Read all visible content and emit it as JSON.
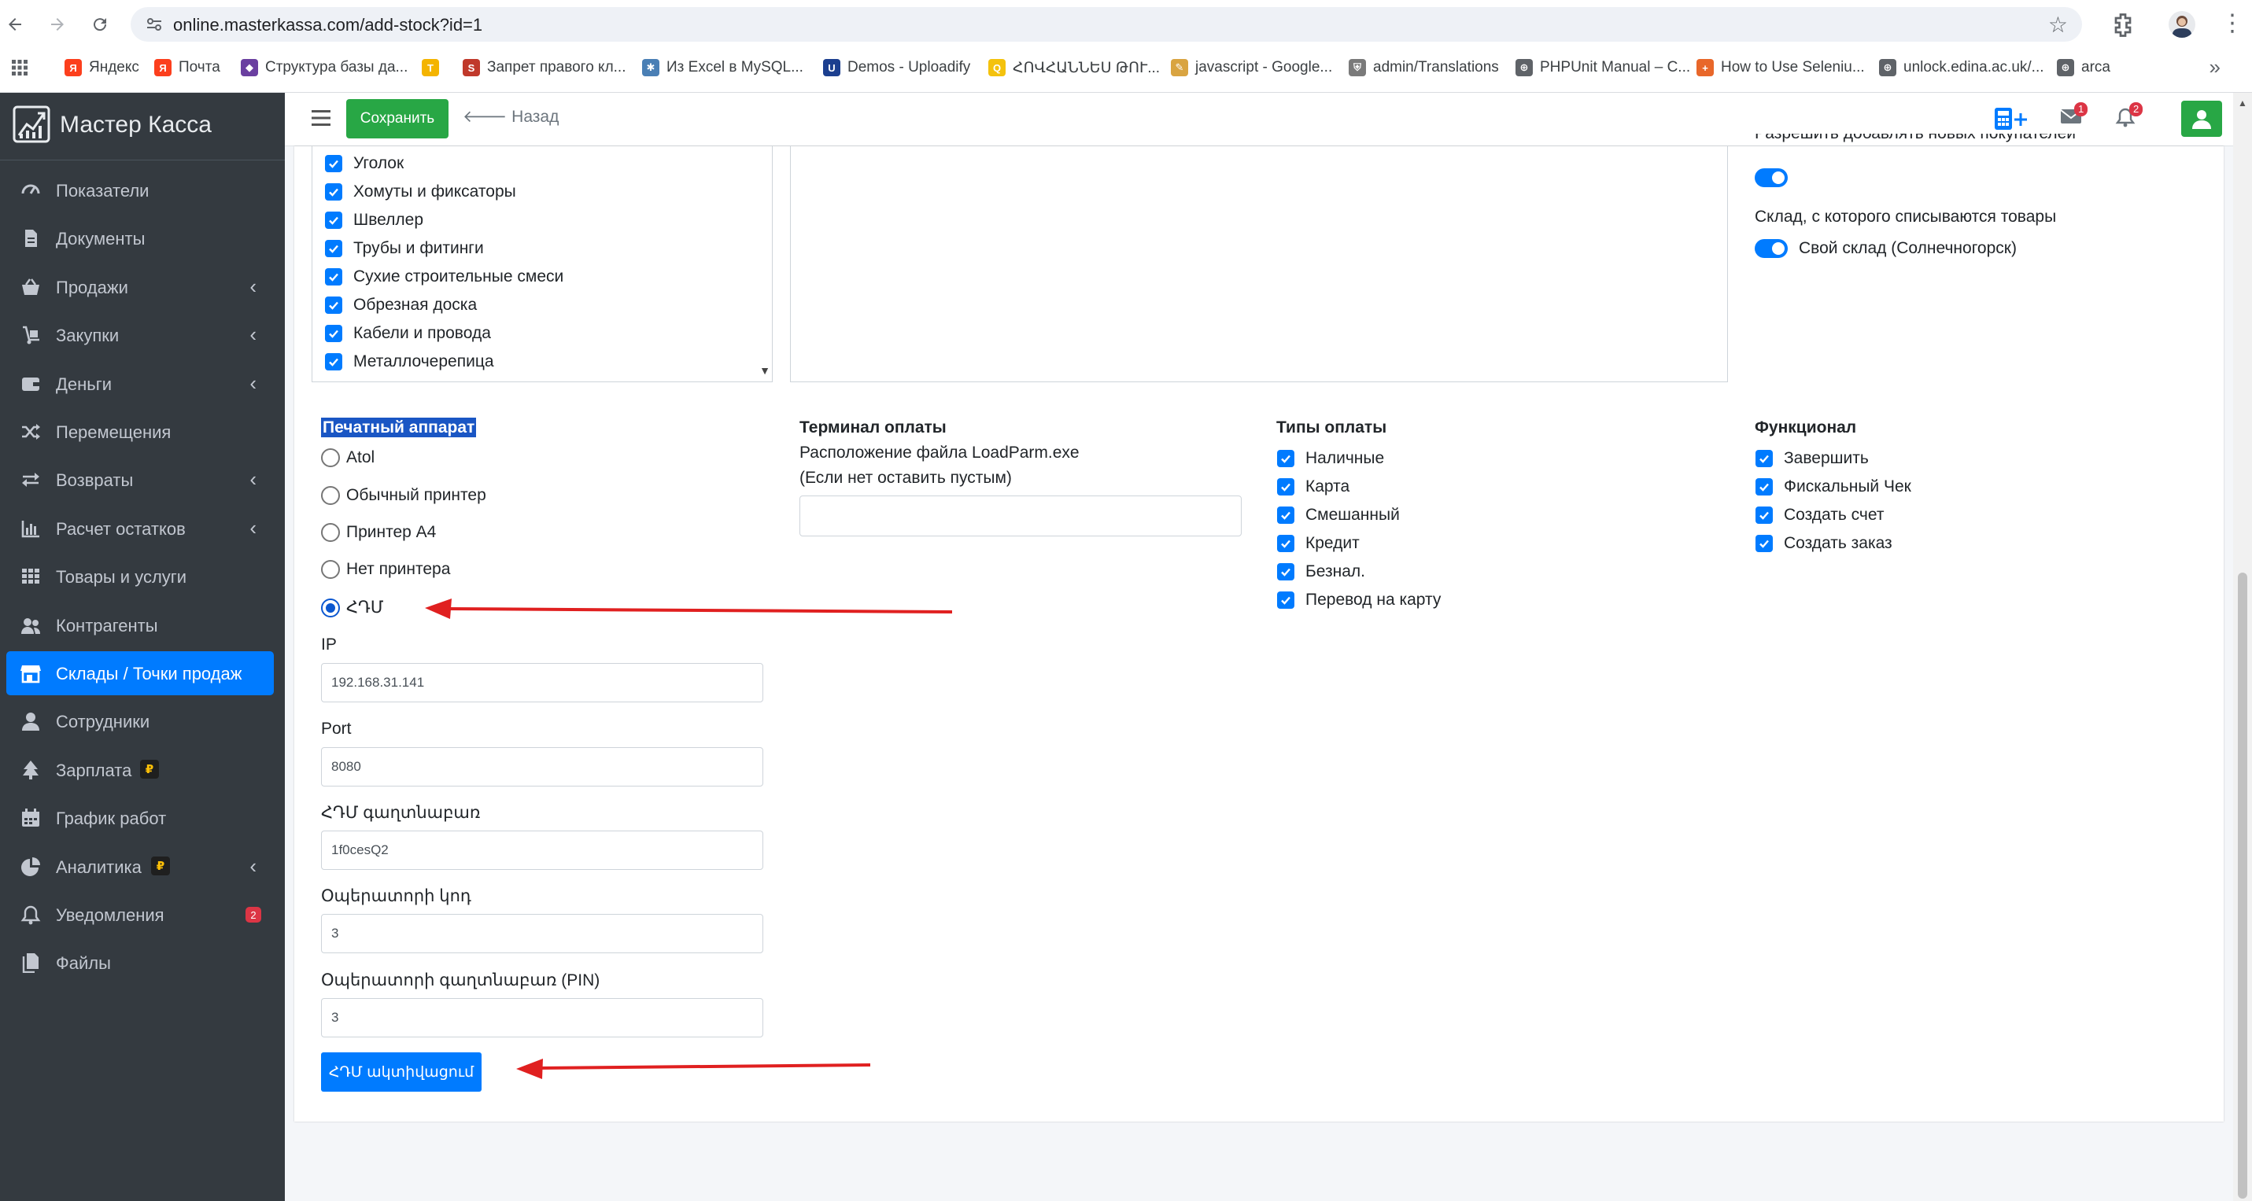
{
  "browser": {
    "url": "online.masterkassa.com/add-stock?id=1",
    "bookmarks": [
      {
        "label": "Яндекс",
        "icon": "yandex-icon",
        "color": "#fc3f1d",
        "glyph": "Я"
      },
      {
        "label": "Почта",
        "icon": "yandex-mail-icon",
        "color": "#fc3f1d",
        "glyph": "Я"
      },
      {
        "label": "Структура базы да...",
        "icon": "diamond-icon",
        "color": "#6a3fa0",
        "glyph": "◆"
      },
      {
        "label": "",
        "icon": "t-icon",
        "color": "#f4b400",
        "glyph": "T"
      },
      {
        "label": "Запрет правого кл...",
        "icon": "s-icon",
        "color": "#c0392b",
        "glyph": "S"
      },
      {
        "label": "Из Excel в MySQL...",
        "icon": "excel-mysql-icon",
        "color": "#4a7fb5",
        "glyph": "✱"
      },
      {
        "label": "Demos - Uploadify",
        "icon": "uploadify-icon",
        "color": "#1c3f8f",
        "glyph": "U"
      },
      {
        "label": "ՀՈՎՀԱՆՆԵՍ ԹՈՒ...",
        "icon": "qr-icon",
        "color": "#f4c20d",
        "glyph": "Q"
      },
      {
        "label": "javascript - Google...",
        "icon": "doc-icon",
        "color": "#d9a441",
        "glyph": "✎"
      },
      {
        "label": "admin/Translations",
        "icon": "shield-icon",
        "color": "#7a7a7a",
        "glyph": "⛨"
      },
      {
        "label": "PHPUnit Manual – C...",
        "icon": "globe-icon",
        "color": "#5f6368",
        "glyph": "⊕"
      },
      {
        "label": "How to Use Seleniu...",
        "icon": "plus-icon",
        "color": "#e8672a",
        "glyph": "+"
      },
      {
        "label": "unlock.edina.ac.uk/...",
        "icon": "globe-icon",
        "color": "#5f6368",
        "glyph": "⊕"
      },
      {
        "label": "arca",
        "icon": "globe-icon",
        "color": "#5f6368",
        "glyph": "⊕"
      }
    ]
  },
  "sidebar": {
    "brand": "Мастер Касса",
    "items": [
      {
        "label": "Показатели",
        "icon": "dashboard-icon",
        "chevron": false
      },
      {
        "label": "Документы",
        "icon": "file-icon",
        "chevron": false
      },
      {
        "label": "Продажи",
        "icon": "basket-icon",
        "chevron": true
      },
      {
        "label": "Закупки",
        "icon": "dolly-icon",
        "chevron": true
      },
      {
        "label": "Деньги",
        "icon": "wallet-icon",
        "chevron": true
      },
      {
        "label": "Перемещения",
        "icon": "shuffle-icon",
        "chevron": false
      },
      {
        "label": "Возвраты",
        "icon": "exchange-icon",
        "chevron": true
      },
      {
        "label": "Расчет остатков",
        "icon": "bar-chart-icon",
        "chevron": true
      },
      {
        "label": "Товары и услуги",
        "icon": "grid-icon",
        "chevron": false
      },
      {
        "label": "Контрагенты",
        "icon": "users-icon",
        "chevron": false
      },
      {
        "label": "Склады / Точки продаж",
        "icon": "store-icon",
        "chevron": false,
        "active": true
      },
      {
        "label": "Сотрудники",
        "icon": "user-icon",
        "chevron": false
      },
      {
        "label": "Зарплата",
        "icon": "tree-icon",
        "chevron": false,
        "coin": "₽"
      },
      {
        "label": "График работ",
        "icon": "calendar-icon",
        "chevron": false
      },
      {
        "label": "Аналитика",
        "icon": "pie-chart-icon",
        "chevron": true,
        "coin": "₽"
      },
      {
        "label": "Уведомления",
        "icon": "bell-icon",
        "chevron": false,
        "badge": "2"
      },
      {
        "label": "Файлы",
        "icon": "files-icon",
        "chevron": false
      }
    ]
  },
  "topbar": {
    "save_label": "Сохранить",
    "back_label": "Назад",
    "mail_badge": "1",
    "bell_badge": "2"
  },
  "categories": [
    "Уголок",
    "Хомуты и фиксаторы",
    "Швеллер",
    "Трубы и фитинги",
    "Сухие строительные смеси",
    "Обрезная доска",
    "Кабели и провода",
    "Металлочерепица"
  ],
  "settings": {
    "cut_label": "Разрешить добавлять новых покупателей",
    "stock_label": "Склад, с которого списываются товары",
    "stock_value": "Свой склад (Солнечногорск)"
  },
  "printer": {
    "title": "Печатный аппарат",
    "options": [
      "Atol",
      "Обычный принтер",
      "Принтер A4",
      "Нет принтера",
      "ՀԴՄ"
    ],
    "selected_index": 4,
    "fields": [
      {
        "label": "IP",
        "value": "192.168.31.141"
      },
      {
        "label": "Port",
        "value": "8080"
      },
      {
        "label": "ՀԴՄ գաղտնաբառ",
        "value": "1f0cesQ2"
      },
      {
        "label": "Օպերատորի կոդ",
        "value": "3"
      },
      {
        "label": "Օպերատորի գաղտնաբառ (PIN)",
        "value": "3"
      }
    ],
    "activate_label": "ՀԴՄ ակտիվացում"
  },
  "terminal": {
    "title": "Терминал оплаты",
    "line1": "Расположение файла LoadParm.exe",
    "line2": "(Если нет оставить пустым)",
    "value": ""
  },
  "payment_types": {
    "title": "Типы оплаты",
    "items": [
      "Наличные",
      "Карта",
      "Смешанный",
      "Кредит",
      "Безнал.",
      "Перевод на карту"
    ]
  },
  "functional": {
    "title": "Функционал",
    "items": [
      "Завершить",
      "Фискальный Чек",
      "Создать счет",
      "Создать заказ"
    ]
  },
  "colors": {
    "sidebar_bg": "#343a40",
    "active": "#007bff",
    "save": "#28a745",
    "arrow": "#e02020"
  }
}
